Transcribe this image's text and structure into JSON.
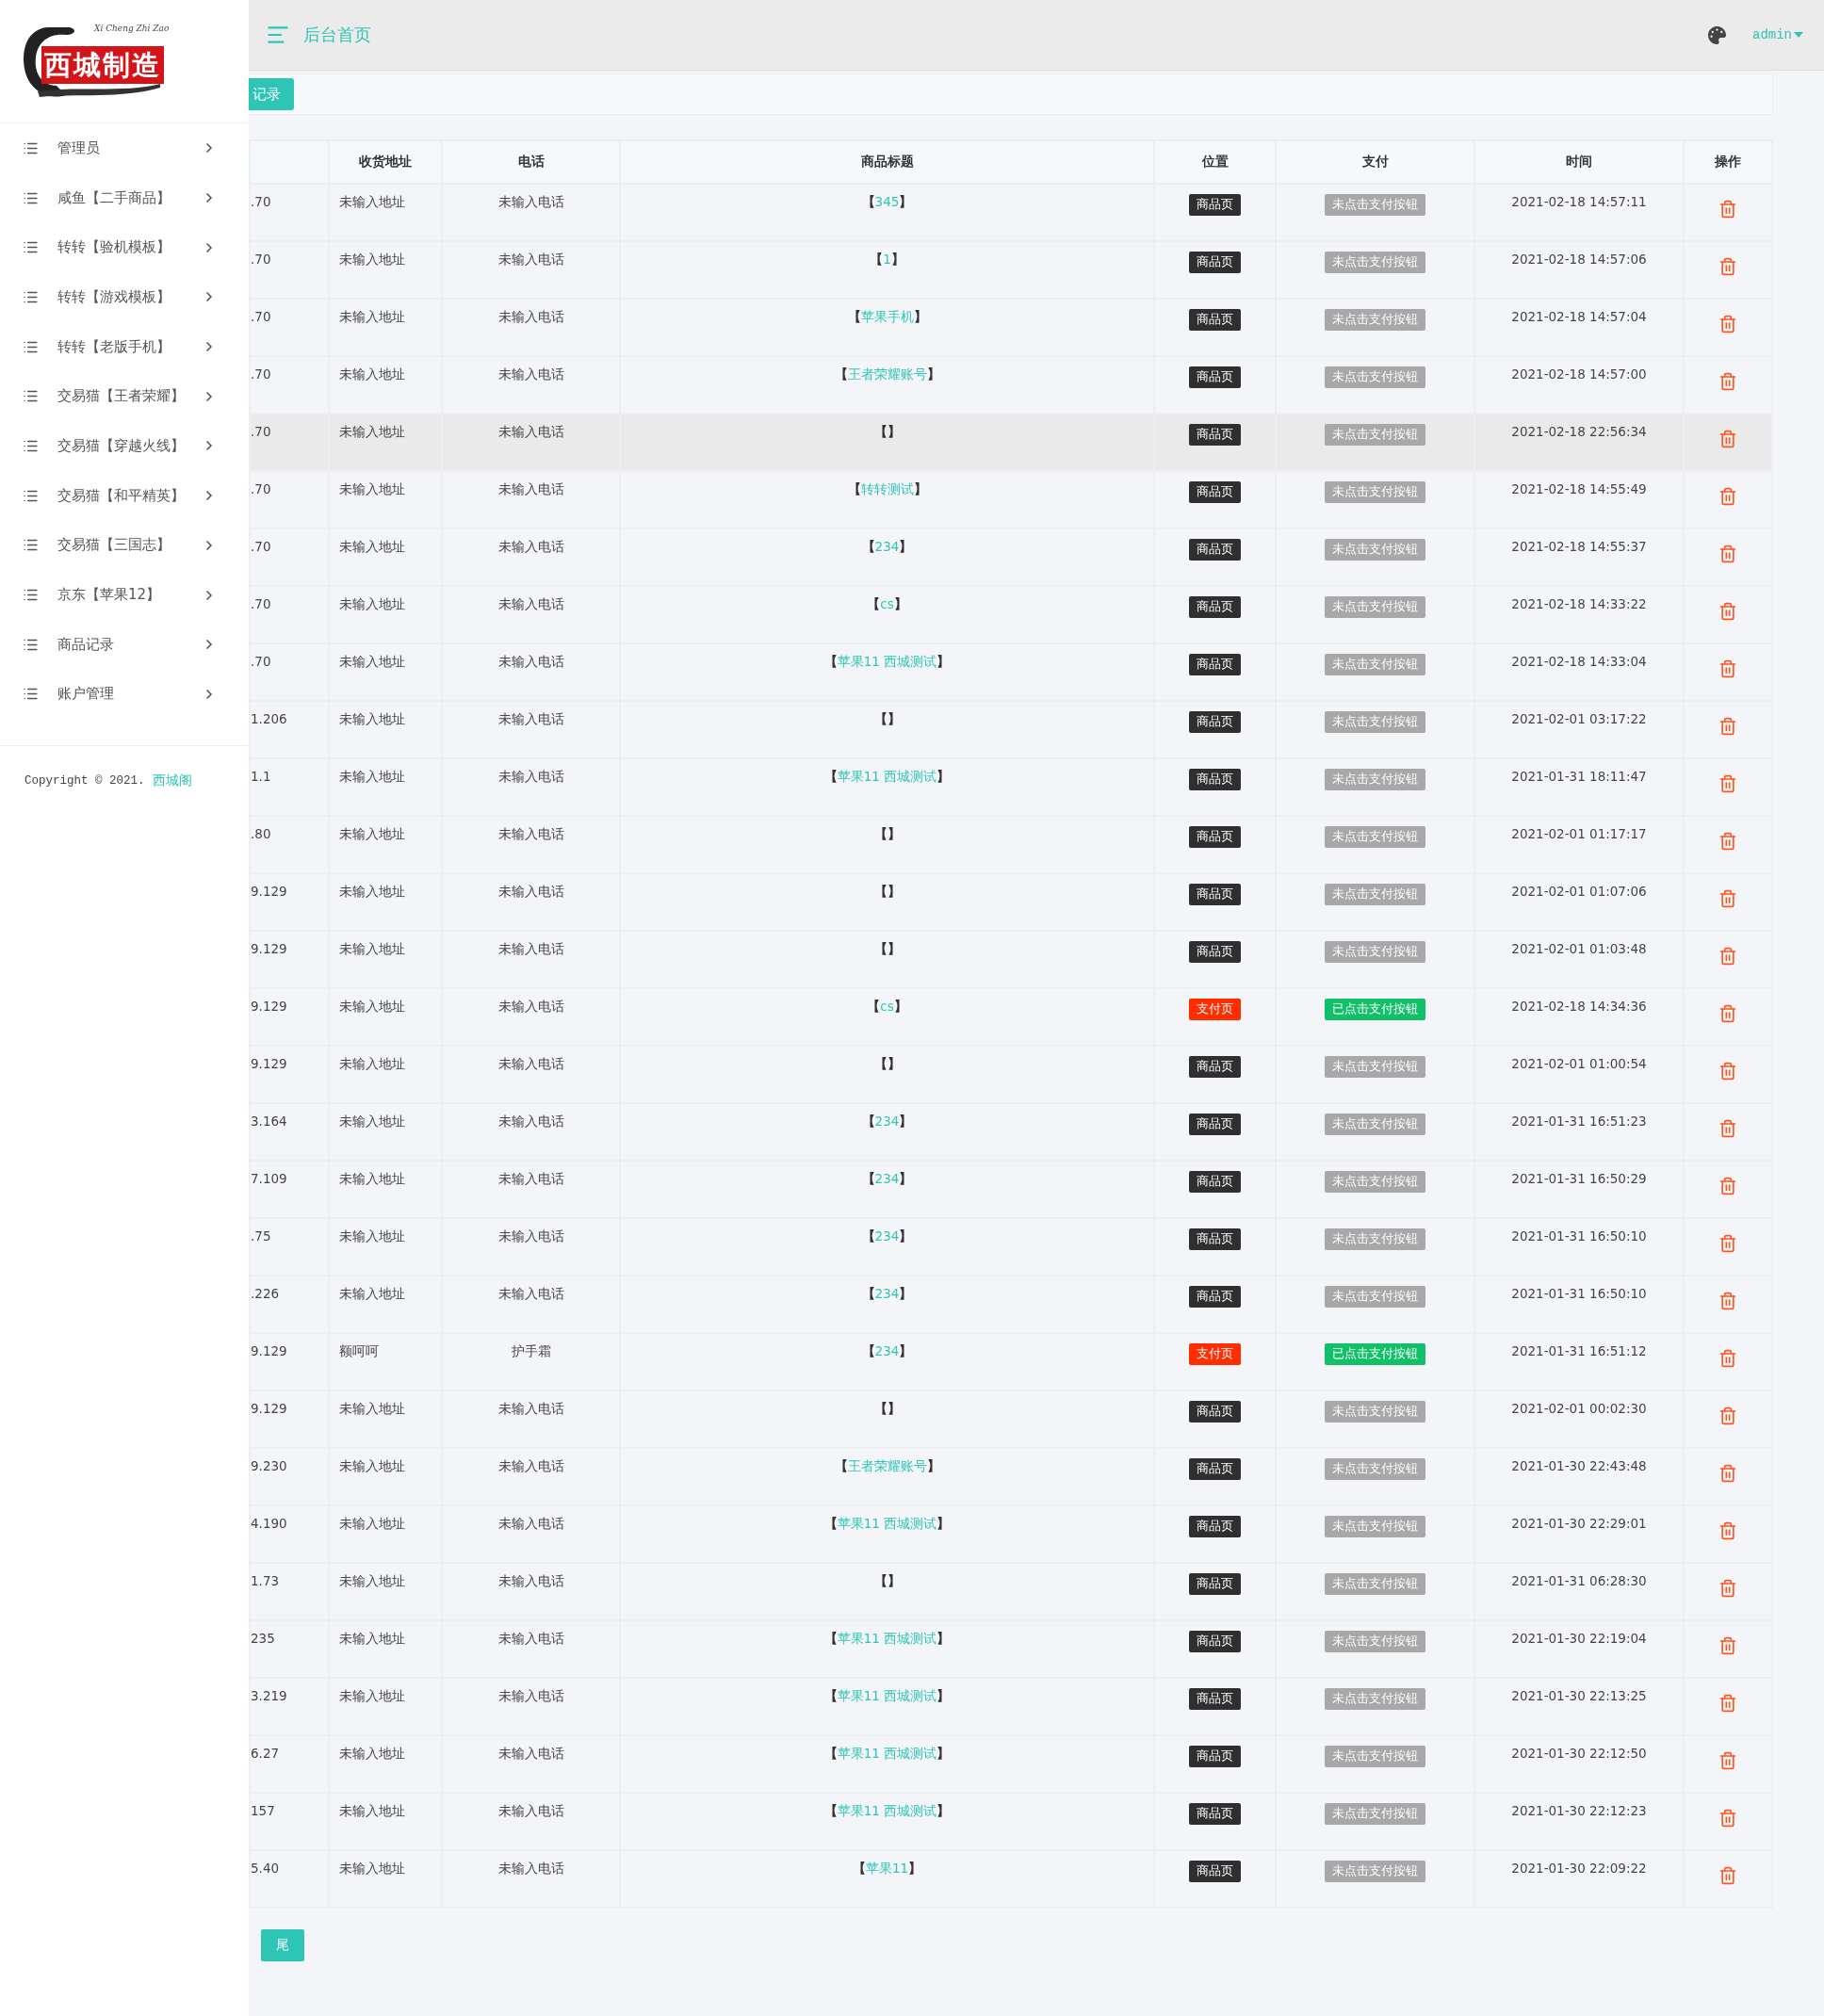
{
  "sidebar": {
    "logo": {
      "script": "Xi Cheng Zhi Zao",
      "stamp": "西城制造"
    },
    "items": [
      {
        "label": "管理员"
      },
      {
        "label": "咸鱼【二手商品】"
      },
      {
        "label": "转转【验机模板】"
      },
      {
        "label": "转转【游戏模板】"
      },
      {
        "label": "转转【老版手机】"
      },
      {
        "label": "交易猫【王者荣耀】"
      },
      {
        "label": "交易猫【穿越火线】"
      },
      {
        "label": "交易猫【和平精英】"
      },
      {
        "label": "交易猫【三国志】"
      },
      {
        "label": "京东【苹果12】"
      },
      {
        "label": "商品记录"
      },
      {
        "label": "账户管理"
      }
    ],
    "copyright": "Copyright © 2021.",
    "copyright_link": "西城阁"
  },
  "header": {
    "title": "后台首页",
    "user": "admin"
  },
  "tab_button": "记录",
  "table": {
    "columns": [
      "",
      "收货地址",
      "电话",
      "商品标题",
      "位置",
      "支付",
      "时间",
      "操作"
    ],
    "brackets": [
      "【",
      "】"
    ],
    "rows": [
      {
        "ip": ".70",
        "address": "未输入地址",
        "phone": "未输入电话",
        "title": "345",
        "position": {
          "kind": "product",
          "label": "商品页"
        },
        "payment": {
          "clicked": false,
          "label": "未点击支付按钮"
        },
        "time": "2021-02-18 14:57:11",
        "hovered": false
      },
      {
        "ip": ".70",
        "address": "未输入地址",
        "phone": "未输入电话",
        "title": "1",
        "position": {
          "kind": "product",
          "label": "商品页"
        },
        "payment": {
          "clicked": false,
          "label": "未点击支付按钮"
        },
        "time": "2021-02-18 14:57:06",
        "hovered": false
      },
      {
        "ip": ".70",
        "address": "未输入地址",
        "phone": "未输入电话",
        "title": "苹果手机",
        "position": {
          "kind": "product",
          "label": "商品页"
        },
        "payment": {
          "clicked": false,
          "label": "未点击支付按钮"
        },
        "time": "2021-02-18 14:57:04",
        "hovered": false
      },
      {
        "ip": ".70",
        "address": "未输入地址",
        "phone": "未输入电话",
        "title": "王者荣耀账号",
        "position": {
          "kind": "product",
          "label": "商品页"
        },
        "payment": {
          "clicked": false,
          "label": "未点击支付按钮"
        },
        "time": "2021-02-18 14:57:00",
        "hovered": false
      },
      {
        "ip": ".70",
        "address": "未输入地址",
        "phone": "未输入电话",
        "position": {
          "kind": "product",
          "label": "商品页"
        },
        "payment": {
          "clicked": false,
          "label": "未点击支付按钮"
        },
        "time": "2021-02-18 22:56:34",
        "hovered": true
      },
      {
        "ip": ".70",
        "address": "未输入地址",
        "phone": "未输入电话",
        "title": "转转测试",
        "position": {
          "kind": "product",
          "label": "商品页"
        },
        "payment": {
          "clicked": false,
          "label": "未点击支付按钮"
        },
        "time": "2021-02-18 14:55:49",
        "hovered": false
      },
      {
        "ip": ".70",
        "address": "未输入地址",
        "phone": "未输入电话",
        "title": "234",
        "position": {
          "kind": "product",
          "label": "商品页"
        },
        "payment": {
          "clicked": false,
          "label": "未点击支付按钮"
        },
        "time": "2021-02-18 14:55:37",
        "hovered": false
      },
      {
        "ip": ".70",
        "address": "未输入地址",
        "phone": "未输入电话",
        "title": "cs",
        "position": {
          "kind": "product",
          "label": "商品页"
        },
        "payment": {
          "clicked": false,
          "label": "未点击支付按钮"
        },
        "time": "2021-02-18 14:33:22",
        "hovered": false
      },
      {
        "ip": ".70",
        "address": "未输入地址",
        "phone": "未输入电话",
        "title": "苹果11 西城测试",
        "position": {
          "kind": "product",
          "label": "商品页"
        },
        "payment": {
          "clicked": false,
          "label": "未点击支付按钮"
        },
        "time": "2021-02-18 14:33:04",
        "hovered": false
      },
      {
        "ip": "1.206",
        "address": "未输入地址",
        "phone": "未输入电话",
        "position": {
          "kind": "product",
          "label": "商品页"
        },
        "payment": {
          "clicked": false,
          "label": "未点击支付按钮"
        },
        "time": "2021-02-01 03:17:22",
        "hovered": false
      },
      {
        "ip": "1.1",
        "address": "未输入地址",
        "phone": "未输入电话",
        "title": "苹果11 西城测试",
        "position": {
          "kind": "product",
          "label": "商品页"
        },
        "payment": {
          "clicked": false,
          "label": "未点击支付按钮"
        },
        "time": "2021-01-31 18:11:47",
        "hovered": false
      },
      {
        "ip": ".80",
        "address": "未输入地址",
        "phone": "未输入电话",
        "position": {
          "kind": "product",
          "label": "商品页"
        },
        "payment": {
          "clicked": false,
          "label": "未点击支付按钮"
        },
        "time": "2021-02-01 01:17:17",
        "hovered": false
      },
      {
        "ip": "9.129",
        "address": "未输入地址",
        "phone": "未输入电话",
        "position": {
          "kind": "product",
          "label": "商品页"
        },
        "payment": {
          "clicked": false,
          "label": "未点击支付按钮"
        },
        "time": "2021-02-01 01:07:06",
        "hovered": false
      },
      {
        "ip": "9.129",
        "address": "未输入地址",
        "phone": "未输入电话",
        "position": {
          "kind": "product",
          "label": "商品页"
        },
        "payment": {
          "clicked": false,
          "label": "未点击支付按钮"
        },
        "time": "2021-02-01 01:03:48",
        "hovered": false
      },
      {
        "ip": "9.129",
        "address": "未输入地址",
        "phone": "未输入电话",
        "title": "cs",
        "position": {
          "kind": "pay",
          "label": "支付页"
        },
        "payment": {
          "clicked": true,
          "label": "已点击支付按钮"
        },
        "time": "2021-02-18 14:34:36",
        "hovered": false
      },
      {
        "ip": "9.129",
        "address": "未输入地址",
        "phone": "未输入电话",
        "position": {
          "kind": "product",
          "label": "商品页"
        },
        "payment": {
          "clicked": false,
          "label": "未点击支付按钮"
        },
        "time": "2021-02-01 01:00:54",
        "hovered": false
      },
      {
        "ip": "3.164",
        "address": "未输入地址",
        "phone": "未输入电话",
        "title": "234",
        "position": {
          "kind": "product",
          "label": "商品页"
        },
        "payment": {
          "clicked": false,
          "label": "未点击支付按钮"
        },
        "time": "2021-01-31 16:51:23",
        "hovered": false
      },
      {
        "ip": "7.109",
        "address": "未输入地址",
        "phone": "未输入电话",
        "title": "234",
        "position": {
          "kind": "product",
          "label": "商品页"
        },
        "payment": {
          "clicked": false,
          "label": "未点击支付按钮"
        },
        "time": "2021-01-31 16:50:29",
        "hovered": false
      },
      {
        "ip": ".75",
        "address": "未输入地址",
        "phone": "未输入电话",
        "title": "234",
        "position": {
          "kind": "product",
          "label": "商品页"
        },
        "payment": {
          "clicked": false,
          "label": "未点击支付按钮"
        },
        "time": "2021-01-31 16:50:10",
        "hovered": false
      },
      {
        "ip": ".226",
        "address": "未输入地址",
        "phone": "未输入电话",
        "title": "234",
        "position": {
          "kind": "product",
          "label": "商品页"
        },
        "payment": {
          "clicked": false,
          "label": "未点击支付按钮"
        },
        "time": "2021-01-31 16:50:10",
        "hovered": false
      },
      {
        "ip": "9.129",
        "address": "额呵呵",
        "phone": "护手霜",
        "title": "234",
        "position": {
          "kind": "pay",
          "label": "支付页"
        },
        "payment": {
          "clicked": true,
          "label": "已点击支付按钮"
        },
        "time": "2021-01-31 16:51:12",
        "hovered": false
      },
      {
        "ip": "9.129",
        "address": "未输入地址",
        "phone": "未输入电话",
        "position": {
          "kind": "product",
          "label": "商品页"
        },
        "payment": {
          "clicked": false,
          "label": "未点击支付按钮"
        },
        "time": "2021-02-01 00:02:30",
        "hovered": false
      },
      {
        "ip": "9.230",
        "address": "未输入地址",
        "phone": "未输入电话",
        "title": "王者荣耀账号",
        "position": {
          "kind": "product",
          "label": "商品页"
        },
        "payment": {
          "clicked": false,
          "label": "未点击支付按钮"
        },
        "time": "2021-01-30 22:43:48",
        "hovered": false
      },
      {
        "ip": "4.190",
        "address": "未输入地址",
        "phone": "未输入电话",
        "title": "苹果11 西城测试",
        "position": {
          "kind": "product",
          "label": "商品页"
        },
        "payment": {
          "clicked": false,
          "label": "未点击支付按钮"
        },
        "time": "2021-01-30 22:29:01",
        "hovered": false
      },
      {
        "ip": "1.73",
        "address": "未输入地址",
        "phone": "未输入电话",
        "position": {
          "kind": "product",
          "label": "商品页"
        },
        "payment": {
          "clicked": false,
          "label": "未点击支付按钮"
        },
        "time": "2021-01-31 06:28:30",
        "hovered": false
      },
      {
        "ip": "235",
        "address": "未输入地址",
        "phone": "未输入电话",
        "title": "苹果11 西城测试",
        "position": {
          "kind": "product",
          "label": "商品页"
        },
        "payment": {
          "clicked": false,
          "label": "未点击支付按钮"
        },
        "time": "2021-01-30 22:19:04",
        "hovered": false
      },
      {
        "ip": "3.219",
        "address": "未输入地址",
        "phone": "未输入电话",
        "title": "苹果11 西城测试",
        "position": {
          "kind": "product",
          "label": "商品页"
        },
        "payment": {
          "clicked": false,
          "label": "未点击支付按钮"
        },
        "time": "2021-01-30 22:13:25",
        "hovered": false
      },
      {
        "ip": "6.27",
        "address": "未输入地址",
        "phone": "未输入电话",
        "title": "苹果11 西城测试",
        "position": {
          "kind": "product",
          "label": "商品页"
        },
        "payment": {
          "clicked": false,
          "label": "未点击支付按钮"
        },
        "time": "2021-01-30 22:12:50",
        "hovered": false
      },
      {
        "ip": "157",
        "address": "未输入地址",
        "phone": "未输入电话",
        "title": "苹果11 西城测试",
        "position": {
          "kind": "product",
          "label": "商品页"
        },
        "payment": {
          "clicked": false,
          "label": "未点击支付按钮"
        },
        "time": "2021-01-30 22:12:23",
        "hovered": false
      },
      {
        "ip": "5.40",
        "address": "未输入地址",
        "phone": "未输入电话",
        "title": "苹果11",
        "position": {
          "kind": "product",
          "label": "商品页"
        },
        "payment": {
          "clicked": false,
          "label": "未点击支付按钮"
        },
        "time": "2021-01-30 22:09:22",
        "hovered": false
      }
    ]
  },
  "pagination": {
    "last": "尾"
  }
}
